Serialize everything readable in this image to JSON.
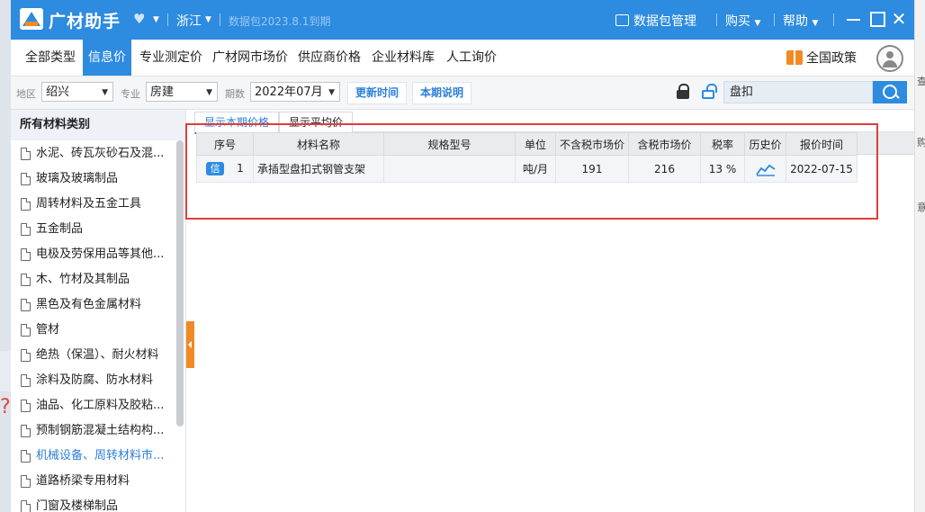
{
  "app": {
    "name": "广材助手",
    "region": "浙江",
    "expire_notice": "数据包2023.8.1到期",
    "data_pkg_label": "数据包管理",
    "buy_label": "购买",
    "help_label": "帮助"
  },
  "menu": {
    "items": [
      "全部类型",
      "信息价",
      "专业测定价",
      "广材网市场价",
      "供应商价格",
      "企业材料库",
      "人工询价"
    ],
    "active": "信息价",
    "policy_label": "全国政策"
  },
  "filters": {
    "area_label": "地区",
    "area_value": "绍兴",
    "major_label": "专业",
    "major_value": "房建",
    "period_label": "期数",
    "period_value": "2022年07月",
    "update_time_btn": "更新时间",
    "period_note_btn": "本期说明",
    "search_value": "盘扣"
  },
  "sidebar": {
    "header": "所有材料类别",
    "selected_index": 13,
    "items": [
      "水泥、砖瓦灰砂石及混...",
      "玻璃及玻璃制品",
      "周转材料及五金工具",
      "五金制品",
      "电极及劳保用品等其他...",
      "木、竹材及其制品",
      "黑色及有色金属材料",
      "管材",
      "绝热（保温）、耐火材料",
      "涂料及防腐、防水材料",
      "油品、化工原料及胶粘...",
      "预制钢筋混凝土结构构...",
      "机械设备、周转材料市...",
      "道路桥梁专用材料",
      "门窗及楼梯制品"
    ]
  },
  "tabs": [
    "显示本期价格",
    "显示平均价"
  ],
  "table": {
    "columns": [
      "序号",
      "材料名称",
      "规格型号",
      "单位",
      "不含税市场价",
      "含税市场价",
      "税率",
      "历史价",
      "报价时间"
    ],
    "rows": [
      {
        "badge": "信",
        "index": "1",
        "name": "承插型盘扣式钢管支架",
        "spec": "",
        "unit": "吨/月",
        "price_ex_tax": "191",
        "price_inc_tax": "216",
        "tax_rate": "13 %",
        "history_icon": "trend-line-icon",
        "quote_date": "2022-07-15"
      }
    ]
  },
  "background": {
    "right_edge_chars": [
      "查",
      "购",
      "意"
    ]
  },
  "colors": {
    "brand_blue": "#2d8be0",
    "highlight_red": "#e03d3d",
    "accent_orange": "#f08a24"
  }
}
